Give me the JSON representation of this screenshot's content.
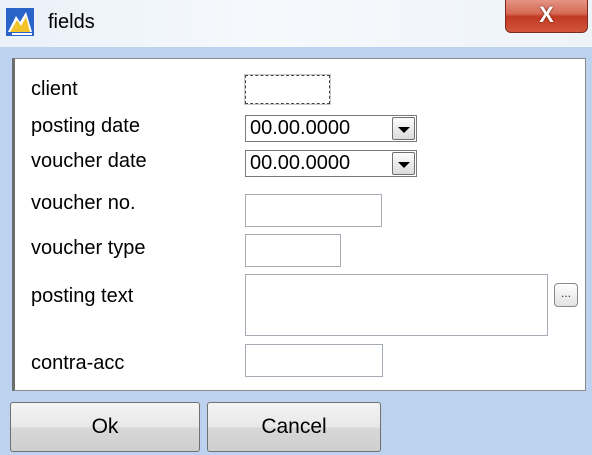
{
  "window": {
    "title": "fields",
    "close_label": "X"
  },
  "form": {
    "client_label": "client",
    "client_value": "",
    "posting_date_label": "posting date",
    "posting_date_value": "00.00.0000",
    "voucher_date_label": "voucher date",
    "voucher_date_value": "00.00.0000",
    "voucher_no_label": "voucher no.",
    "voucher_no_value": "",
    "voucher_type_label": "voucher type",
    "voucher_type_value": "",
    "posting_text_label": "posting text",
    "posting_text_value": "",
    "posting_text_button_label": "...",
    "contra_acc_label": "contra-acc",
    "contra_acc_value": ""
  },
  "buttons": {
    "ok_label": "Ok",
    "cancel_label": "Cancel"
  },
  "icons": {
    "app": "app-icon",
    "dropdown": "chevron-down-icon",
    "close": "close-icon"
  },
  "colors": {
    "window_bg": "#bcd2ee",
    "close_red": "#c23a22"
  }
}
